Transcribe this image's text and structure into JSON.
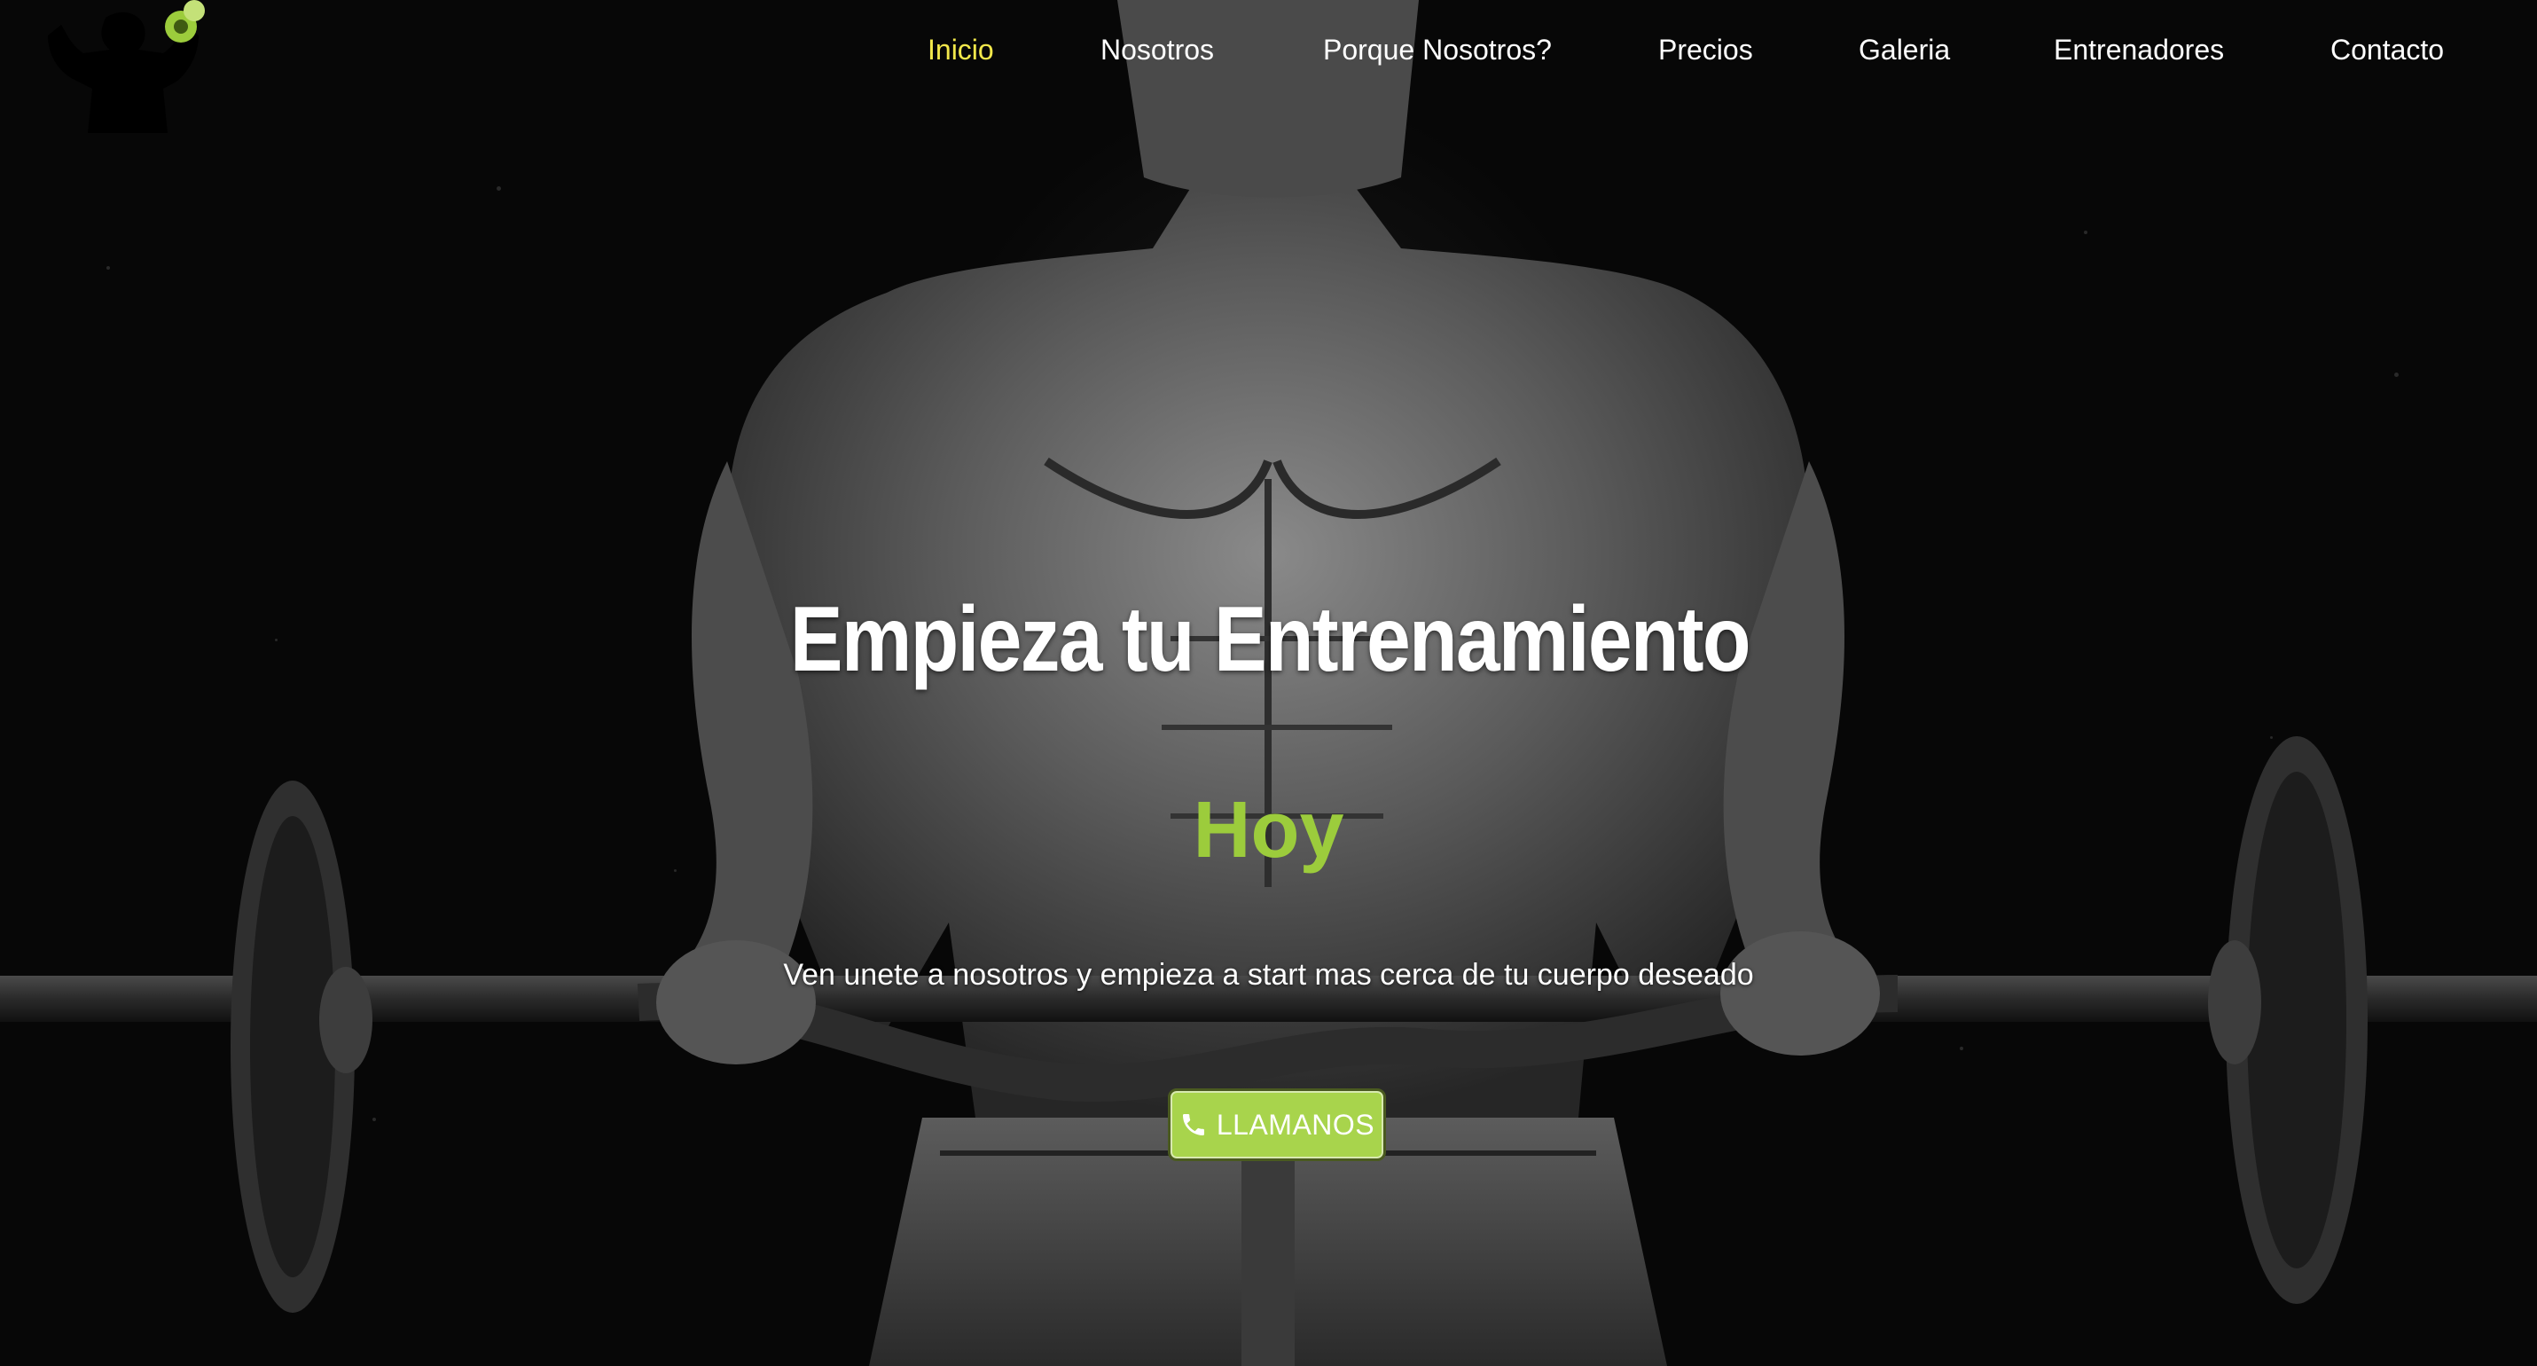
{
  "nav": {
    "items": [
      {
        "label": "Inicio",
        "active": true
      },
      {
        "label": "Nosotros",
        "active": false
      },
      {
        "label": "Porque Nosotros?",
        "active": false
      },
      {
        "label": "Precios",
        "active": false
      },
      {
        "label": "Galeria",
        "active": false
      },
      {
        "label": "Entrenadores",
        "active": false
      },
      {
        "label": "Contacto",
        "active": false
      }
    ]
  },
  "hero": {
    "headline": "Empieza tu Entrenamiento",
    "highlight": "Hoy",
    "tagline": "Ven unete a nosotros y empieza a start mas cerca de tu cuerpo deseado",
    "cta_label": "LLAMANOS",
    "cta_icon": "phone-icon"
  },
  "colors": {
    "accent": "#a8d44c",
    "active_nav": "#f2e84b",
    "text": "#ffffff",
    "background": "#0b0b0b"
  },
  "logo": {
    "icon": "bodybuilder-with-dumbbell-icon"
  }
}
